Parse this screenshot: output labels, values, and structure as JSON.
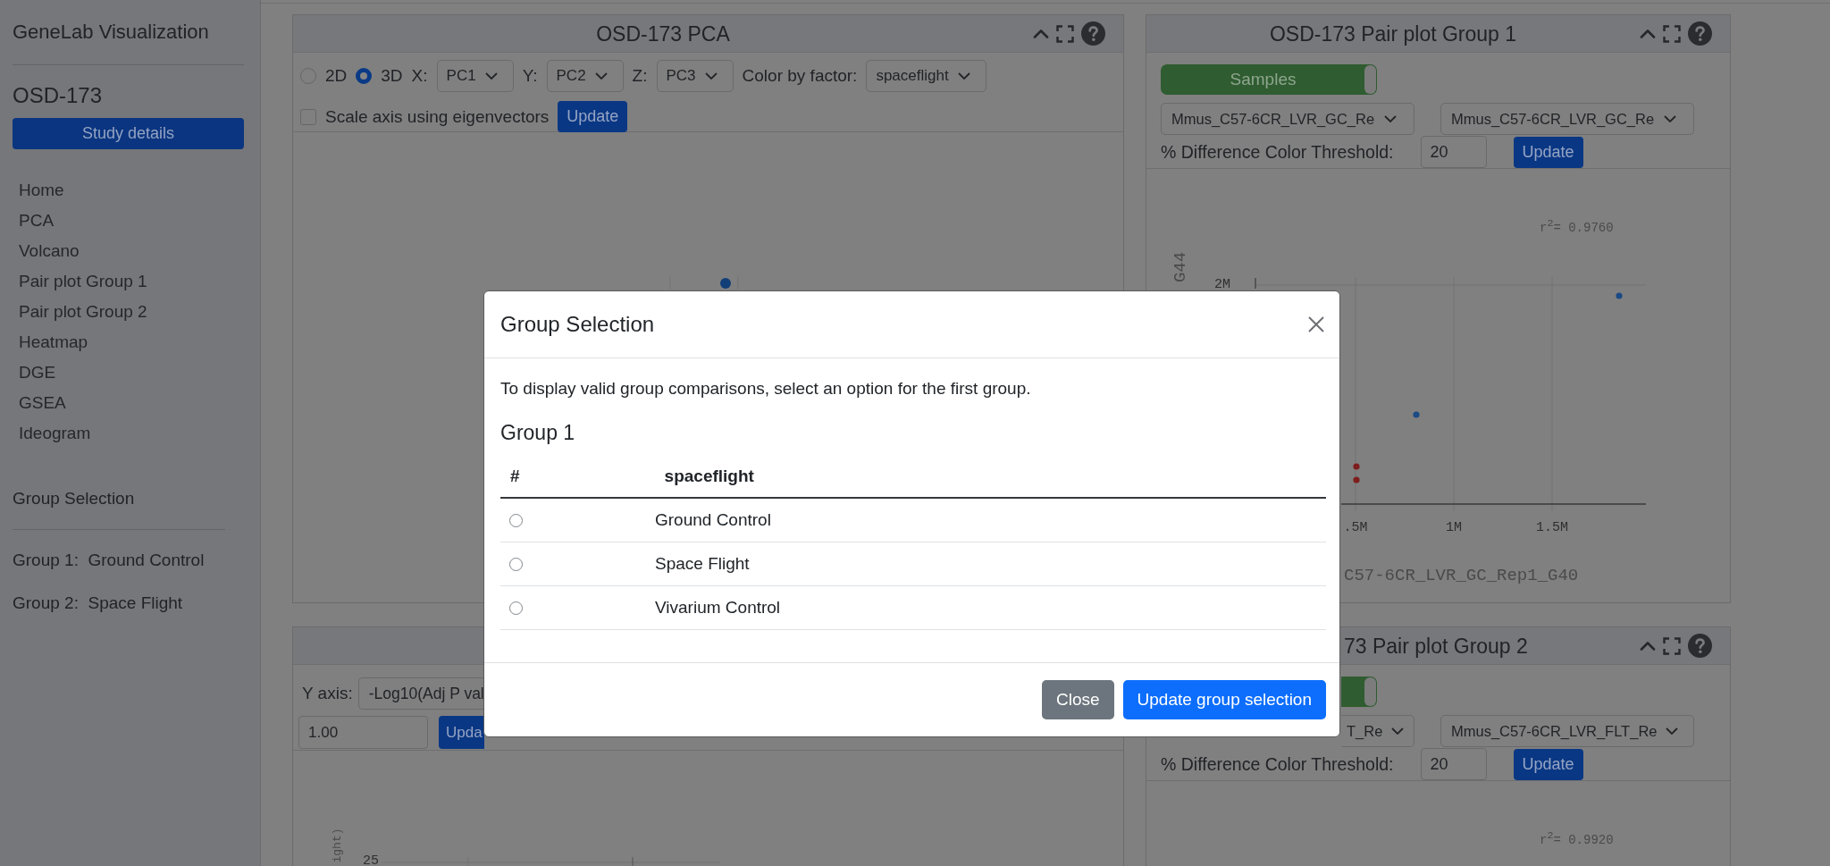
{
  "sidebar": {
    "title": "GeneLab Visualization",
    "study_id": "OSD-173",
    "study_button": "Study details",
    "nav_items": [
      {
        "label": "Home"
      },
      {
        "label": "PCA"
      },
      {
        "label": "Volcano"
      },
      {
        "label": "Pair plot Group 1"
      },
      {
        "label": "Pair plot Group 2"
      },
      {
        "label": "Heatmap"
      },
      {
        "label": "DGE"
      },
      {
        "label": "GSEA"
      },
      {
        "label": "Ideogram"
      }
    ],
    "group_heading": "Group Selection",
    "groups": [
      "Group 1:  Ground Control",
      "Group 2:  Space Flight"
    ]
  },
  "pca_panel": {
    "title": "OSD-173 PCA",
    "dimension_options": [
      {
        "label": "2D",
        "selected": false
      },
      {
        "label": "3D",
        "selected": true
      }
    ],
    "axes": [
      {
        "label": "X:",
        "value": "PC1"
      },
      {
        "label": "Y:",
        "value": "PC2"
      },
      {
        "label": "Z:",
        "value": "PC3"
      }
    ],
    "color_by": {
      "label": "Color by factor:",
      "value": "spaceflight"
    },
    "scale_axis": {
      "label": "Scale axis using eigenvectors",
      "checked": false
    },
    "update_button": "Update"
  },
  "pair_plot_panels": [
    {
      "title": "OSD-173 Pair plot Group 1",
      "toggle": {
        "label": "Samples",
        "on": true
      },
      "samples": [
        "Mmus_C57-6CR_LVR_GC_Re",
        "Mmus_C57-6CR_LVR_GC_Re"
      ],
      "threshold_label": "% Difference Color Threshold:",
      "threshold_value": "20",
      "update_button": "Update",
      "chart": {
        "r_squared": "r$^{2}$= 0.9760",
        "ylabel": "G44",
        "yticks": [
          "2M"
        ],
        "xticks": [
          ".5M",
          "1M",
          "1.5M"
        ],
        "xlabel": "C57-6CR_LVR_GC_Rep1_G40"
      }
    },
    {
      "title": "73 Pair plot Group 2",
      "toggle": {
        "on": true
      },
      "samples": [
        "T_Re",
        "Mmus_C57-6CR_LVR_FLT_Re"
      ],
      "threshold_label": "% Difference Color Threshold:",
      "threshold_value": "20",
      "update_button": "Update",
      "chart": {
        "r_squared": "r$^{2}$= 0.9920"
      }
    }
  ],
  "volcano_panel": {
    "y_axis": {
      "label": "Y axis:",
      "value": "-Log10(Adj P val"
    },
    "threshold_value": "1.00",
    "update_button": "Upda",
    "chart": {
      "ylabel": "ight)",
      "yticks": [
        "25"
      ]
    }
  },
  "modal": {
    "title": "Group Selection",
    "intro": "To display valid group comparisons, select an option for the first group.",
    "group_heading": "Group 1",
    "columns": [
      "#",
      "spaceflight"
    ],
    "options": [
      {
        "label": "Ground Control",
        "selected": false
      },
      {
        "label": "Space Flight",
        "selected": false
      },
      {
        "label": "Vivarium Control",
        "selected": false
      }
    ],
    "buttons": [
      {
        "label": "Close",
        "kind": "secondary"
      },
      {
        "label": "Update group selection",
        "kind": "primary"
      }
    ]
  }
}
